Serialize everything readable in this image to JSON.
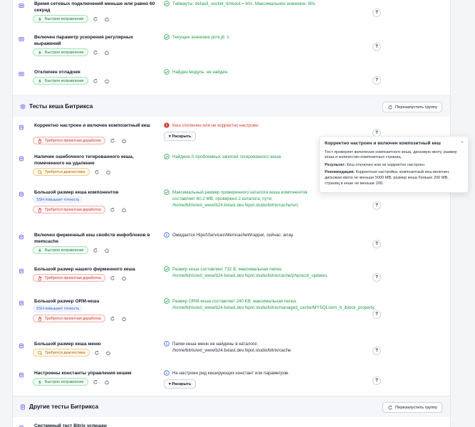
{
  "colors": {
    "ok": "#1f9d4c",
    "error": "#d43b2a",
    "info": "#2563eb",
    "accent": "#4f46e5"
  },
  "rows_top": [
    {
      "id": "r1",
      "title": "Время сетевых подключений меньше или равно 60 секунд",
      "tags": [
        {
          "label": "Быстрое исправление",
          "kind": "green"
        }
      ],
      "status": "ok",
      "message": "Таймауты: default_socket_timeout = 60s. Максимальное значение: 60s.",
      "help": "?",
      "icon": "settings-icon"
    },
    {
      "id": "r2",
      "title": "Включен параметр ускорения регулярных выражений",
      "tags": [
        {
          "label": "Быстрое исправление",
          "kind": "green"
        }
      ],
      "status": "ok",
      "message": "Текущее значение pcre.jit: 1.",
      "help": "?",
      "icon": "settings-icon"
    },
    {
      "id": "r3",
      "title": "Отключен отладчик",
      "tags": [
        {
          "label": "Быстрое исправление",
          "kind": "green"
        }
      ],
      "status": "ok",
      "message": "Найден модуль: не найден.",
      "help": "?",
      "icon": "settings-icon"
    }
  ],
  "group1": {
    "title": "Тесты кеша Битрикса",
    "rerun": "Перезапустить группу",
    "icon": "layers-icon"
  },
  "rows_cache": [
    {
      "id": "c1",
      "title": "Корректно настроен и включен композитный кеш",
      "tags": [
        {
          "label": "Требуется проектная доработка",
          "kind": "red"
        }
      ],
      "status": "err",
      "message": "Кеш отключен или не корректно настроен",
      "expand": "▾ Раскрыть",
      "help": "?"
    },
    {
      "id": "c2",
      "title": "Наличие ошибочного тегированного кеша, помеченного на удаление",
      "tags": [
        {
          "label": "Требуется диагностика",
          "kind": "orange"
        }
      ],
      "status": "ok",
      "message": "Найдено 0 проблемных записей тегированного кеша.",
      "help": "?"
    },
    {
      "id": "c3",
      "title": "Большой размер кеша компонентов",
      "precision": "SSH повышает точность",
      "tags": [
        {
          "label": "Требуется проектная доработка",
          "kind": "red"
        }
      ],
      "status": "ok",
      "message": "Максимальный размер проверенного каталога кеша компонентов составляет 60.2 MB; проверено 2 каталога; пути: /home/bitrix/ext_www/b24.bxlast.dev.hipot.studio/bitrix/cache/sm.",
      "help": "?"
    },
    {
      "id": "c4",
      "title": "Включен фирменный кеш свойств инфоблоков в memcache",
      "tags": [
        {
          "label": "Быстрое исправление",
          "kind": "green"
        }
      ],
      "status": "info",
      "message": "Ожидается Hipot\\Services\\MemcacheWrapper, сейчас: array.",
      "help": "?"
    },
    {
      "id": "c5",
      "title": "Большой размер нашего фирменного кеша",
      "tags": [
        {
          "label": "Требуется проектная доработка",
          "kind": "red"
        }
      ],
      "status": "ok",
      "message": "Размер кеша составляет 732 B; максимальная папка: /home/bitrix/ext_www/b24.bxlast.dev.hipot.studio/bitrix/cache/php/acrit_updates.",
      "help": "?"
    },
    {
      "id": "c6",
      "title": "Большой размер ORM-кеша",
      "precision": "SSH повышает точность",
      "tags": [
        {
          "label": "Требуется проектная доработка",
          "kind": "red"
        }
      ],
      "status": "ok",
      "message": "Размер ORM-кеша составляет 240 KB; максимальная папка: /home/bitrix/ext_www/b24.bxlast.dev.hipot.studio/bitrix/managed_cache/MYSQL/orm_b_iblock_property.",
      "help": "?"
    },
    {
      "id": "c7",
      "title": "Большой размер кеша меню",
      "tags": [
        {
          "label": "Требуется диагностика",
          "kind": "orange"
        }
      ],
      "status": "info",
      "message": "Папки кеша меню не найдены в каталоге: /home/bitrix/ext_www/b24.bxlast.dev.hipot.studio/bitrix/cache.",
      "help": "?"
    },
    {
      "id": "c8",
      "title": "Настроены константы управления кешем",
      "tags": [
        {
          "label": "Быстрое исправление",
          "kind": "green"
        }
      ],
      "status": "info",
      "message": "Не настроен ряд кеширующих констант или параметров.",
      "expand": "▾ Раскрыть",
      "help": "?"
    }
  ],
  "group2": {
    "title": "Другие тесты Битрикса",
    "rerun": "Перезапустить группу",
    "icon": "document-icon"
  },
  "row_last": {
    "title": "Системный тест Bitrix успешен"
  },
  "tooltip": {
    "title": "Корректно настроен и включен композитный кеш",
    "description": "Тест проверяет включение композитного кеша, дисковую квоту, размер кеша и количество композитных страниц.",
    "result_label": "Результат:",
    "result_text": "Кеш отключен или не корректно настроен",
    "rec_label": "Рекомендация:",
    "rec_text": "Корректная настройка: композитный кеш включен, дисковая квота не меньше 5000 MB, размер кеша больше 200 MB, страниц в кеше не меньше 200.",
    "close": "×"
  }
}
